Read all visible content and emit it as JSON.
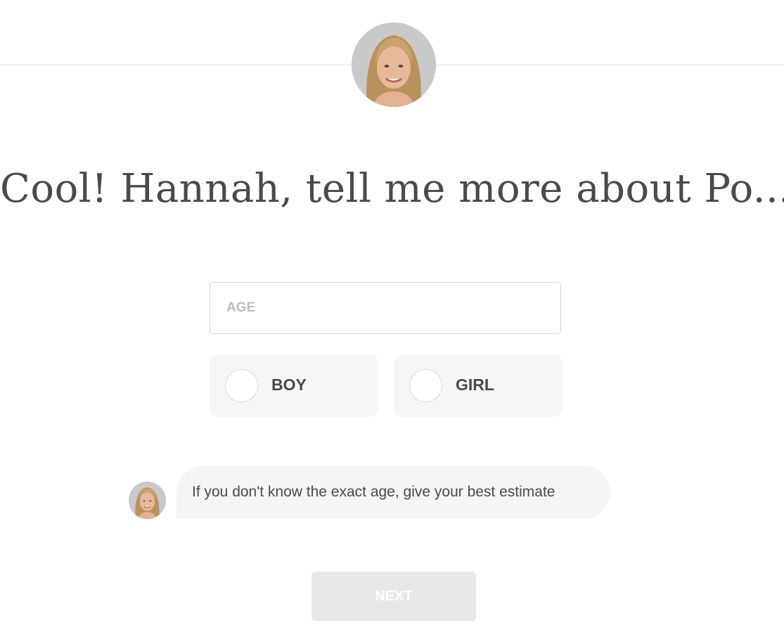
{
  "heading": "Cool! Hannah, tell me more about Po...",
  "form": {
    "age_placeholder": "AGE",
    "age_value": "",
    "gender_options": [
      {
        "label": "BOY",
        "selected": false
      },
      {
        "label": "GIRL",
        "selected": false
      }
    ]
  },
  "hint": {
    "text": "If you don't know the exact age, give your best estimate"
  },
  "next_button": {
    "label": "NEXT",
    "enabled": false
  },
  "colors": {
    "text": "#4a4a4a",
    "option_bg": "#f6f6f6",
    "button_disabled_bg": "#e8e8e8",
    "divider": "#dcdcdc"
  },
  "icons": {
    "assistant_avatar": "avatar-photo"
  }
}
